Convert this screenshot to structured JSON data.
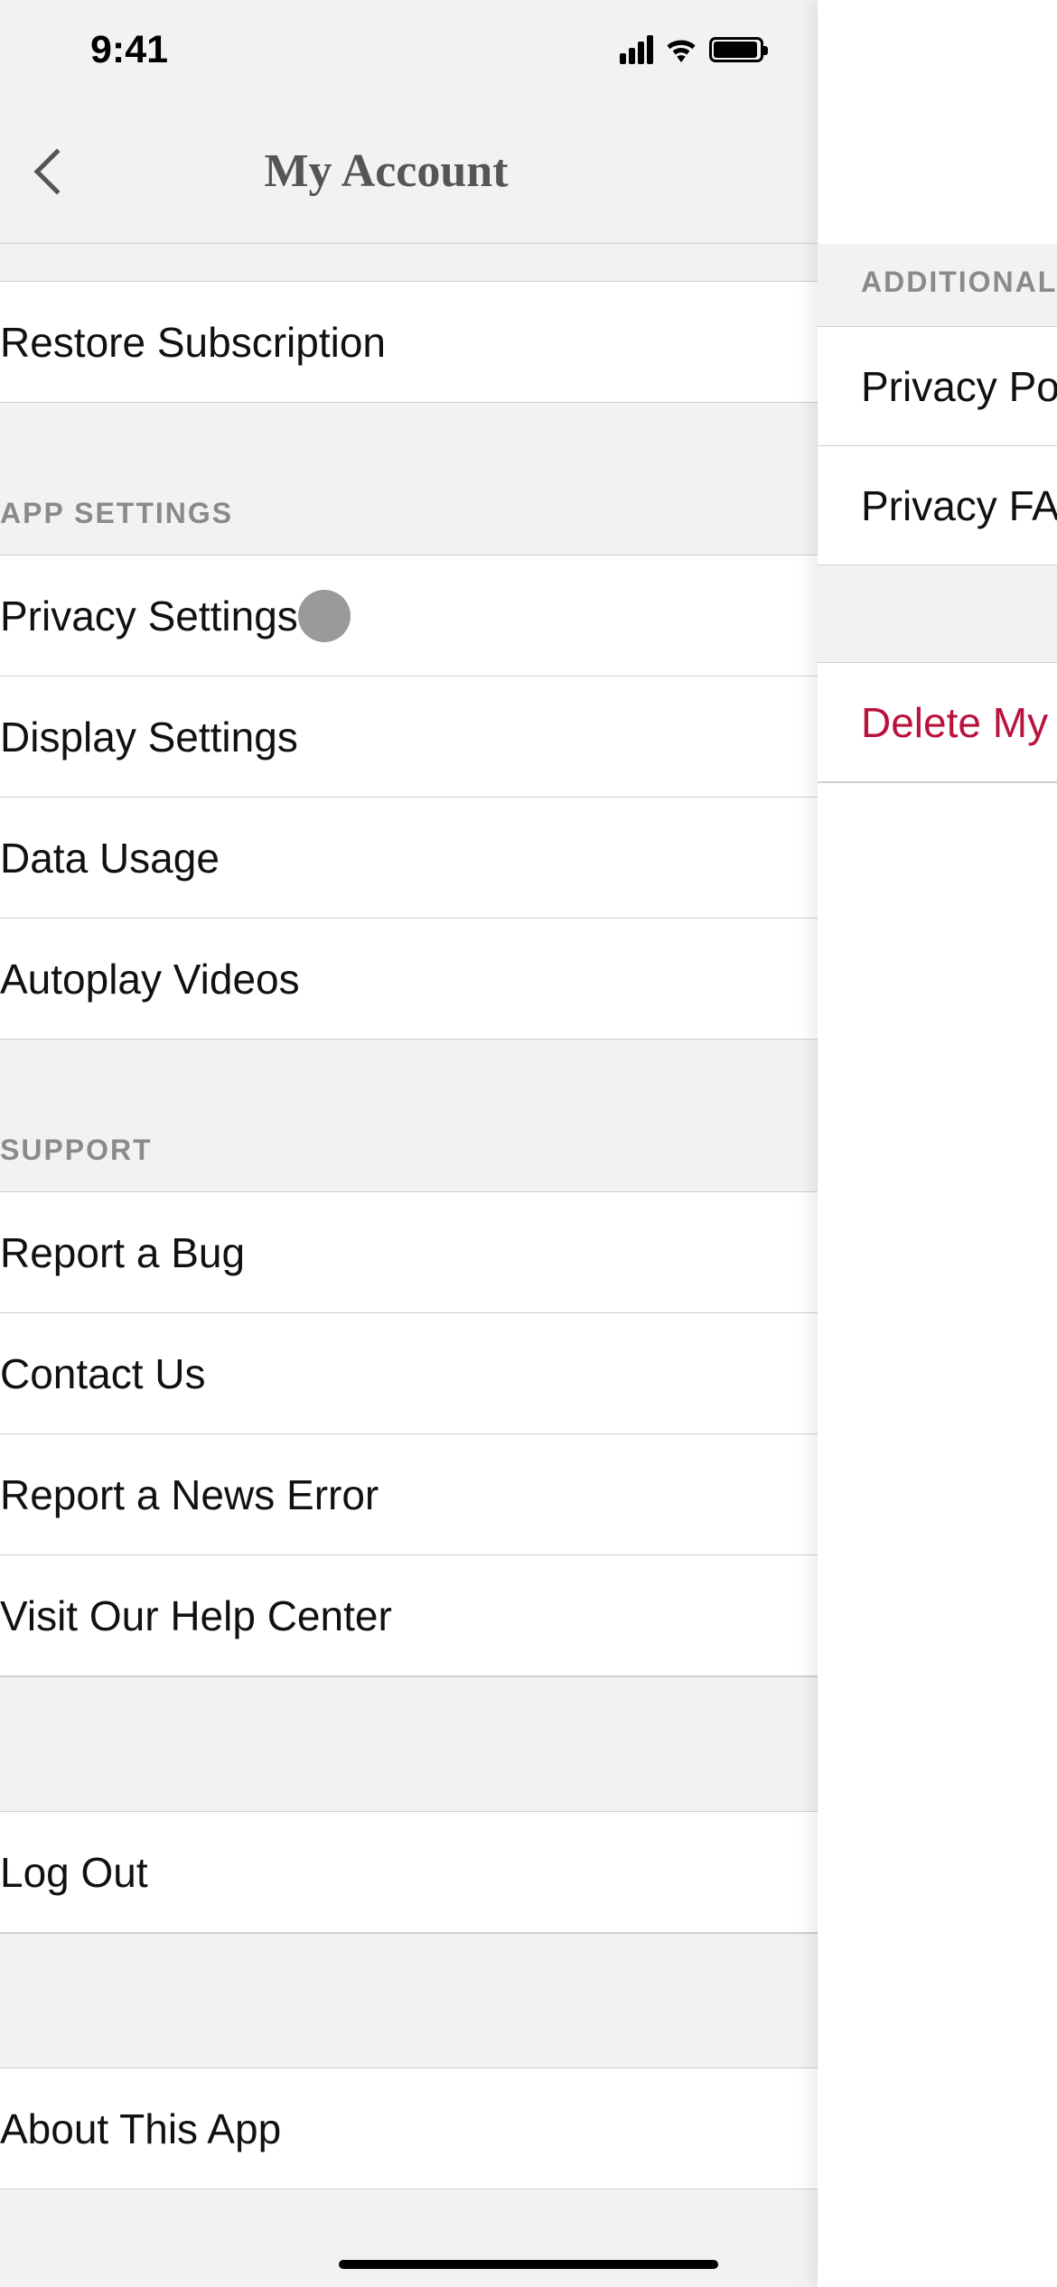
{
  "status": {
    "time": "9:41"
  },
  "left": {
    "title": "My Account",
    "rows": {
      "restore": "Restore Subscription",
      "app_settings_header": "APP SETTINGS",
      "privacy_settings": "Privacy Settings",
      "display_settings": "Display Settings",
      "data_usage": "Data Usage",
      "autoplay": "Autoplay Videos",
      "support_header": "SUPPORT",
      "report_bug": "Report a Bug",
      "contact": "Contact Us",
      "report_news_error": "Report a News Error",
      "help_center": "Visit Our Help Center",
      "log_out": "Log Out",
      "about": "About This App"
    }
  },
  "right": {
    "additional_header": "ADDITIONAL",
    "privacy_policy": "Privacy Policy",
    "privacy_faq": "Privacy FAQ",
    "delete": "Delete My Data"
  }
}
